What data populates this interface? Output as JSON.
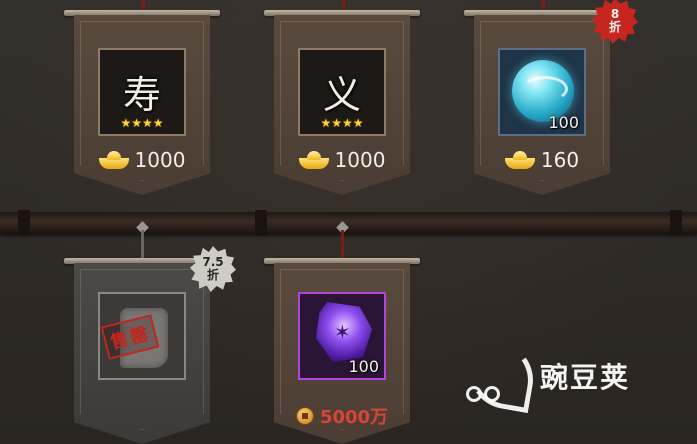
{
  "shop": {
    "top_row": [
      {
        "glyph": "寿",
        "stars": "★★★★",
        "price": "1000",
        "currency": "ingot-icon"
      },
      {
        "glyph": "义",
        "stars": "★★★★",
        "price": "1000",
        "currency": "ingot-icon"
      },
      {
        "count": "100",
        "price": "160",
        "currency": "ingot-icon",
        "badge": {
          "line1": "8",
          "line2": "折"
        }
      }
    ],
    "bottom_row": [
      {
        "seal": "售罄",
        "badge": {
          "line1": "7.5",
          "line2": "折"
        }
      },
      {
        "count": "100",
        "price": "5000万",
        "currency": "copper-coin-icon"
      }
    ]
  },
  "watermark": {
    "text": "豌豆荚"
  },
  "colors": {
    "badge_red": "#c7251f",
    "badge_silver": "#cfcbc5",
    "price_red": "#d8443a",
    "rare_purple": "#b445d9"
  }
}
